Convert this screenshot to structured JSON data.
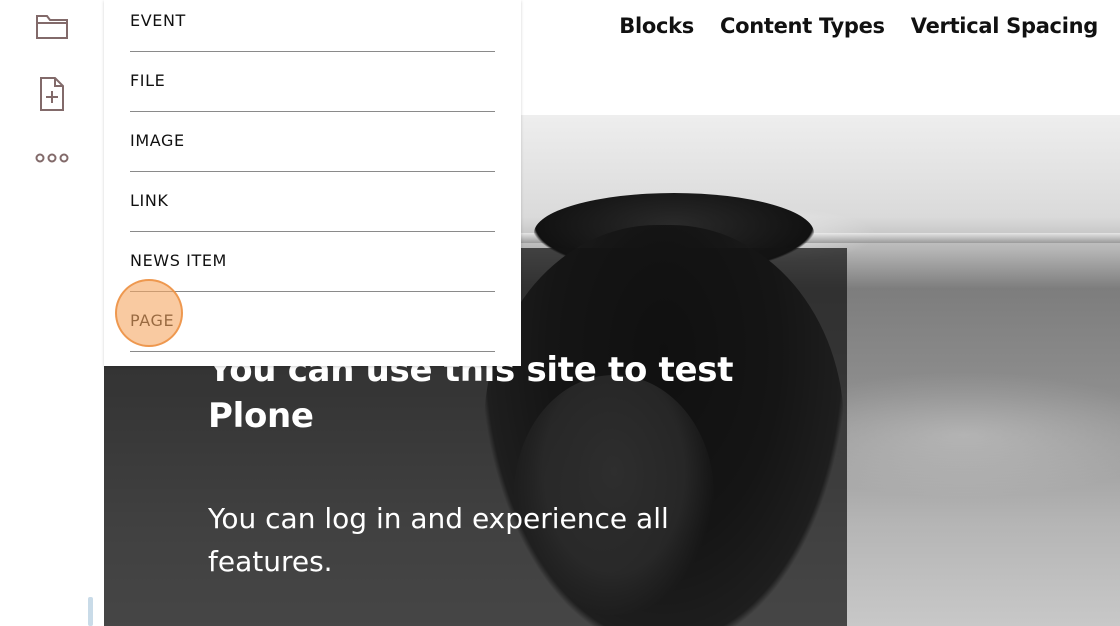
{
  "toolbar": {
    "buttons": [
      {
        "name": "folder-icon",
        "label": "Contents"
      },
      {
        "name": "add-page-icon",
        "label": "Add"
      },
      {
        "name": "more-icon",
        "label": "More"
      }
    ]
  },
  "nav": {
    "items": [
      "Blocks",
      "Content Types",
      "Vertical Spacing"
    ]
  },
  "add_menu": {
    "items": [
      "EVENT",
      "FILE",
      "IMAGE",
      "LINK",
      "NEWS ITEM",
      "PAGE"
    ],
    "highlighted": "PAGE"
  },
  "hero": {
    "title": "You can use this site to test Plone",
    "description": "You can log in and experience all features."
  },
  "colors": {
    "icon": "#826a6a",
    "click_marker": "#f5a662",
    "menu_divider": "#8a8a8a",
    "scrollbar": "#c9dbe8"
  }
}
